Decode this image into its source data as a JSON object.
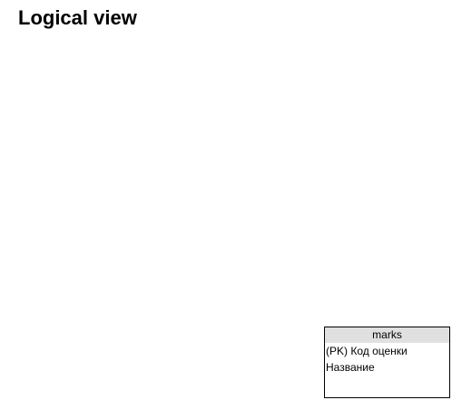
{
  "page": {
    "title": "Logical view"
  },
  "diagram": {
    "entities": [
      {
        "name": "marks",
        "fields": [
          "(PK) Код оценки",
          "Название"
        ]
      }
    ]
  },
  "colors": {
    "entity_header_bg": "#e0e0e0",
    "entity_border": "#000000"
  }
}
